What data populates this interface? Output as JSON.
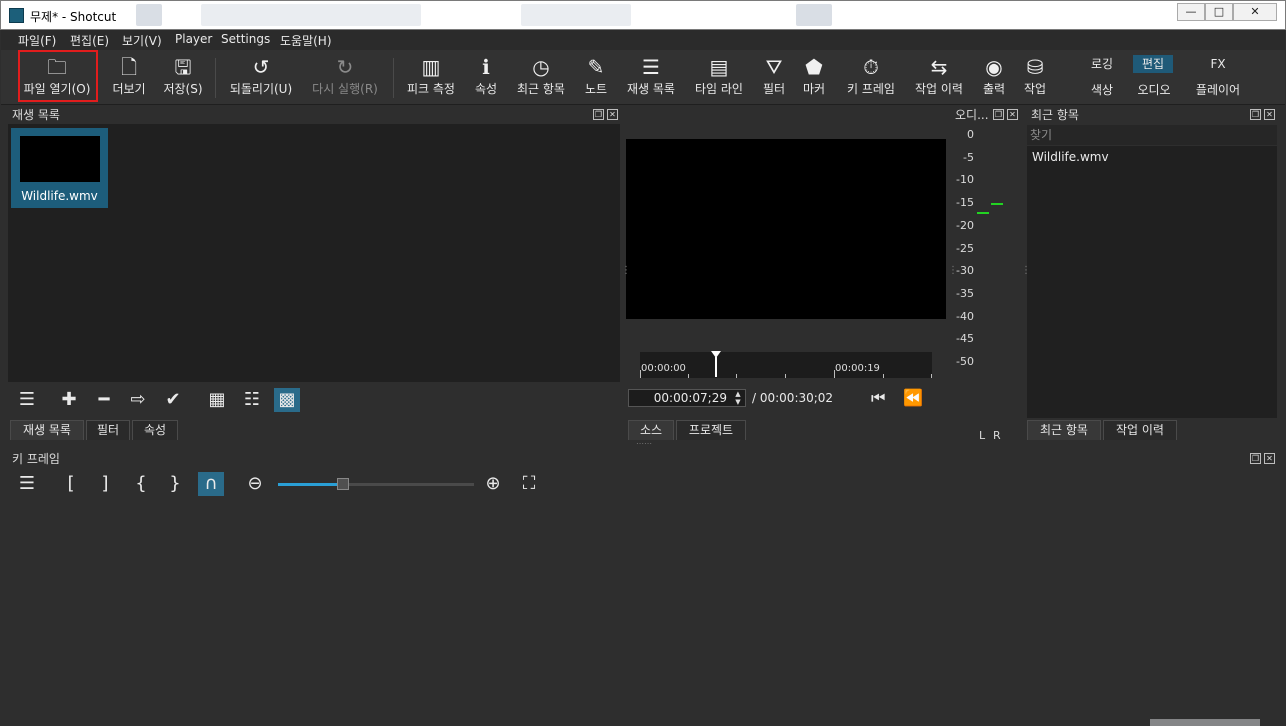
{
  "window": {
    "title": "무제* - Shotcut",
    "minimize": "—",
    "maximize": "□",
    "close": "✕"
  },
  "menu": [
    "파일(F)",
    "편집(E)",
    "보기(V)",
    "Player",
    "Settings",
    "도움말(H)"
  ],
  "toolbar": {
    "open_file": "파일 열기(O)",
    "more": "더보기",
    "save": "저장(S)",
    "undo": "되돌리기(U)",
    "redo": "다시 실행(R)",
    "peak_meter": "피크 측정",
    "properties": "속성",
    "recent": "최근 항목",
    "notes": "노트",
    "playlist": "재생 목록",
    "timeline": "타임 라인",
    "filters": "필터",
    "markers": "마커",
    "keyframes": "키 프레임",
    "history": "작업 이력",
    "export": "출력",
    "jobs": "작업"
  },
  "layouts": {
    "logging": "로깅",
    "editing": "편집",
    "fx": "FX",
    "color": "색상",
    "audio": "오디오",
    "player": "플레이어",
    "active": "편집"
  },
  "playlist": {
    "title": "재생 목록",
    "clips": [
      {
        "name": "Wildlife.wmv"
      }
    ],
    "tabs": [
      "재생 목록",
      "필터",
      "속성"
    ]
  },
  "player": {
    "ruler_start": "00:00:00",
    "ruler_mark": "00:00:19",
    "current_time": "00:00:07;29",
    "total_time": "/ 00:00:30;02",
    "tabs": [
      "소스",
      "프로젝트"
    ]
  },
  "audio": {
    "title": "오디...",
    "scale": [
      "0",
      "-5",
      "-10",
      "-15",
      "-20",
      "-25",
      "-30",
      "-35",
      "-40",
      "-45",
      "-50"
    ],
    "channels": [
      "L",
      "R"
    ],
    "level_left_db": -17,
    "level_right_db": -15,
    "accent_color": "#22d322"
  },
  "recent": {
    "title": "최근 항목",
    "search_placeholder": "찾기",
    "items": [
      "Wildlife.wmv"
    ],
    "tabs": [
      "최근 항목",
      "작업 이력"
    ]
  },
  "keyframes": {
    "title": "키 프레임",
    "zoom_level": 0.33
  },
  "colors": {
    "selection": "#1d5d7b",
    "highlight": "#e11d1d"
  }
}
